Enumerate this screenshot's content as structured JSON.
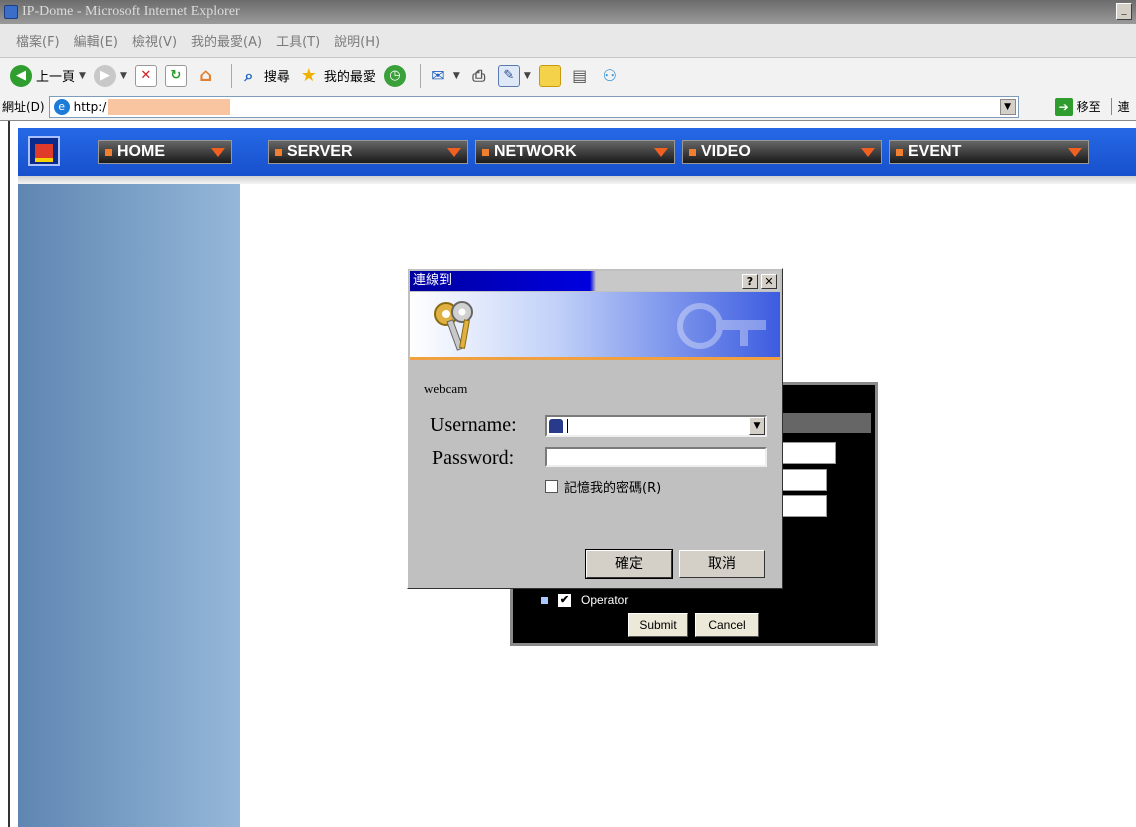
{
  "window": {
    "title": "IP-Dome - Microsoft Internet Explorer",
    "minimize_glyph": "_"
  },
  "menu": [
    "檔案(F)",
    "編輯(E)",
    "檢視(V)",
    "我的最愛(A)",
    "工具(T)",
    "說明(H)"
  ],
  "toolbar": {
    "back_label": "上一頁",
    "search_label": "搜尋",
    "favorites_label": "我的最愛",
    "icons": [
      "back-icon",
      "forward-icon",
      "stop-icon",
      "refresh-icon",
      "home-icon",
      "search-icon",
      "favorites-star-icon",
      "history-icon",
      "mail-icon",
      "print-icon",
      "edit-icon",
      "folder-icon",
      "research-icon",
      "messenger-icon"
    ]
  },
  "address": {
    "label": "網址(D)",
    "url": "http:/",
    "go_label": "移至",
    "links_edge": "連"
  },
  "nav": {
    "items": [
      "HOME",
      "SERVER",
      "NETWORK",
      "VIDEO",
      "EVENT"
    ]
  },
  "background_form": {
    "operator_label": "Operator",
    "submit_label": "Submit",
    "cancel_label": "Cancel"
  },
  "dialog": {
    "title": "連線到",
    "help_glyph": "?",
    "close_glyph": "✕",
    "realm": "webcam",
    "username_label": "Username:",
    "password_label": "Password:",
    "remember_label": "記憶我的密碼(R)",
    "ok_label": "確定",
    "cancel_label": "取消"
  },
  "colors": {
    "nav_blue": "#1d5ad8",
    "sidebar_blue": "#7fa3c8",
    "dialog_title_blue": "#0000c0",
    "nav_arrow": "#f06020"
  }
}
